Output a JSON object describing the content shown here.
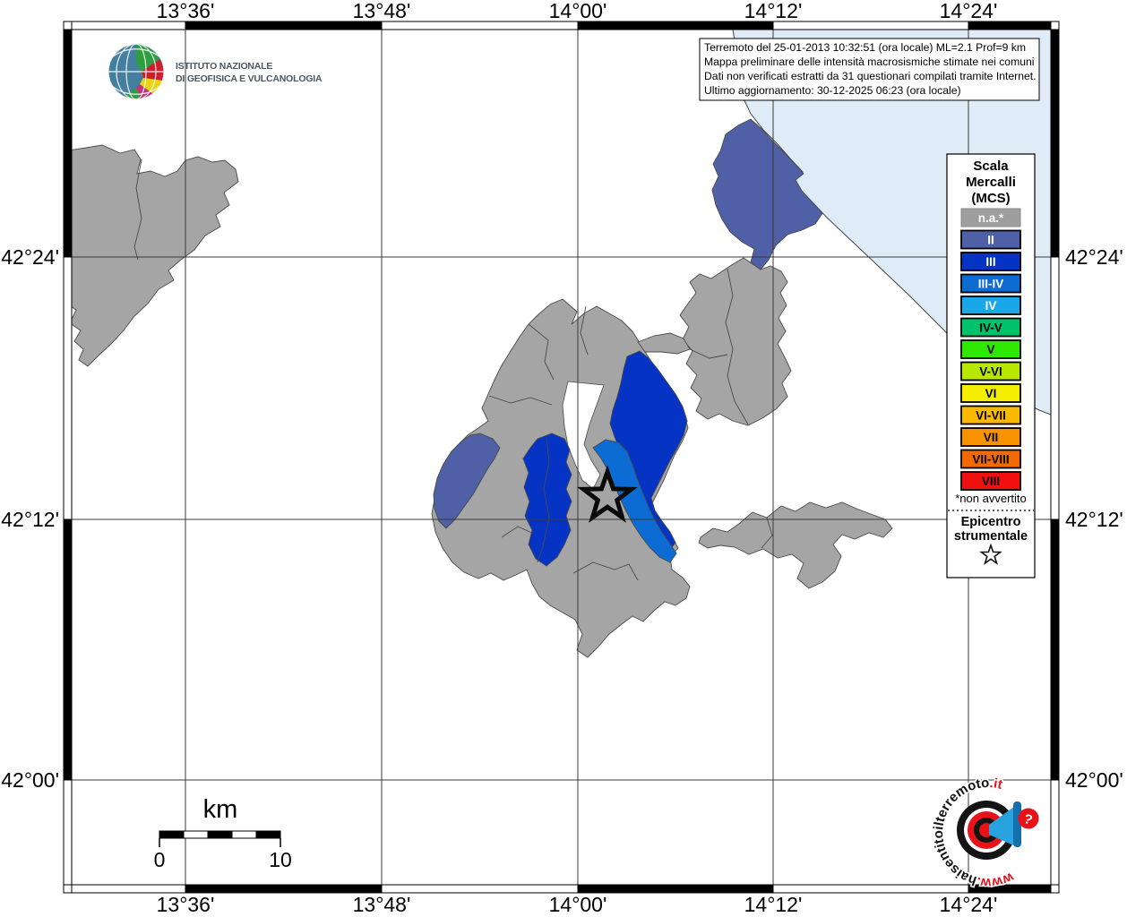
{
  "branding": {
    "org_line1": "ISTITUTO NAZIONALE",
    "org_line2": "DI GEOFISICA E VULCANOLOGIA"
  },
  "info_box": {
    "line1": "Terremoto del 25-01-2013 10:32:51 (ora locale) ML=2.1 Prof=9 km",
    "line2": "Mappa preliminare delle intensità macrosismiche stimate nei comuni",
    "line3": "Dati non verificati estratti da 31 questionari compilati tramite Internet.",
    "line4": "Ultimo aggiornamento: 30-12-2025 06:23 (ora locale)"
  },
  "legend": {
    "title_line1": "Scala",
    "title_line2": "Mercalli",
    "title_line3": "(MCS)",
    "items": [
      {
        "label": "n.a.*",
        "color": "#9e9e9e",
        "text_color": "#ffffff"
      },
      {
        "label": "II",
        "color": "#4f60a7",
        "text_color": "#ffffff"
      },
      {
        "label": "III",
        "color": "#0533c4",
        "text_color": "#ffffff"
      },
      {
        "label": "III-IV",
        "color": "#0d6bd4",
        "text_color": "#ffffff"
      },
      {
        "label": "IV",
        "color": "#1aa7e8",
        "text_color": "#ffffff"
      },
      {
        "label": "IV-V",
        "color": "#00c26a",
        "text_color": "#000000"
      },
      {
        "label": "V",
        "color": "#2fe800",
        "text_color": "#000000"
      },
      {
        "label": "V-VI",
        "color": "#b9e800",
        "text_color": "#000000"
      },
      {
        "label": "VI",
        "color": "#f6ee00",
        "text_color": "#000000"
      },
      {
        "label": "VI-VII",
        "color": "#fab800",
        "text_color": "#000000"
      },
      {
        "label": "VII",
        "color": "#f99200",
        "text_color": "#000000"
      },
      {
        "label": "VII-VIII",
        "color": "#f26900",
        "text_color": "#000000"
      },
      {
        "label": "VIII",
        "color": "#f01010",
        "text_color": "#000000"
      }
    ],
    "footnote": "*non avvertito",
    "epicenter_line1": "Epicentro",
    "epicenter_line2": "strumentale"
  },
  "axes": {
    "lon": [
      "13°36'",
      "13°48'",
      "14°00'",
      "14°12'",
      "14°24'"
    ],
    "lat": [
      "42°24'",
      "42°12'",
      "42°00'"
    ]
  },
  "scale_bar": {
    "unit": "km",
    "min": "0",
    "max": "10"
  },
  "watermark": {
    "prefix": "www.",
    "name": "haisentitoilterremoto",
    "suffix": ".it",
    "question_mark": "?"
  },
  "map": {
    "colors": {
      "sea": "#dfecf8",
      "municipality": "#a5a5a5",
      "land": "#ffffff"
    }
  }
}
